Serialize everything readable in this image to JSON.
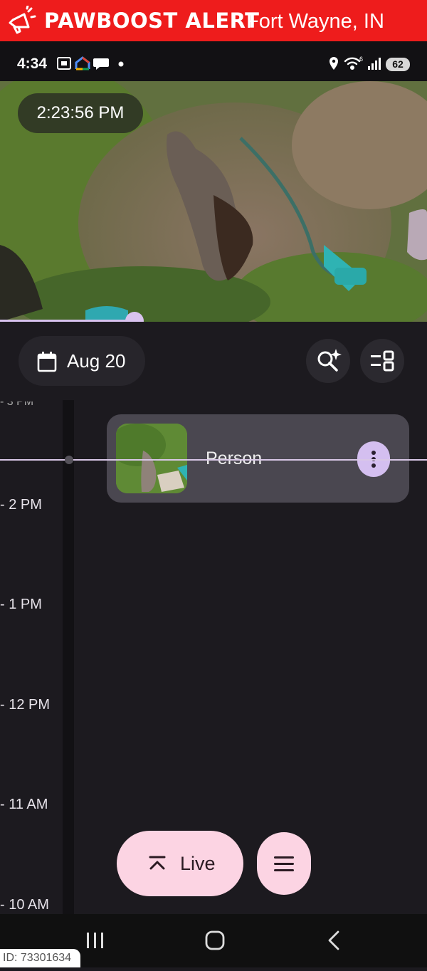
{
  "banner": {
    "brand": "PAWBOOST ALERT",
    "location": "Fort Wayne, IN",
    "icon": "megaphone-icon",
    "color": "#ee1c1c"
  },
  "status_bar": {
    "time": "4:34",
    "battery": "62",
    "icons": [
      "screenshot-icon",
      "google-home-icon",
      "chat-icon",
      "dot-icon",
      "location-icon",
      "wifi-icon",
      "signal-icon"
    ]
  },
  "camera": {
    "timestamp": "2:23:56 PM"
  },
  "toolbar": {
    "date_label": "Aug 20",
    "search_icon": "sparkle-search-icon",
    "view_icon": "view-toggle-icon"
  },
  "timeline": {
    "hours": [
      "- 2 PM",
      "- 1 PM",
      "- 12 PM",
      "- 11 AM",
      "- 10 AM"
    ],
    "event": {
      "label": "Person"
    }
  },
  "actions": {
    "live_label": "Live",
    "menu_icon": "menu-icon"
  },
  "footer": {
    "id_text": "ID: 73301634"
  },
  "colors": {
    "accent": "#d9c3ef",
    "live_button": "#fcd4e3",
    "background": "#1c1a1f"
  }
}
